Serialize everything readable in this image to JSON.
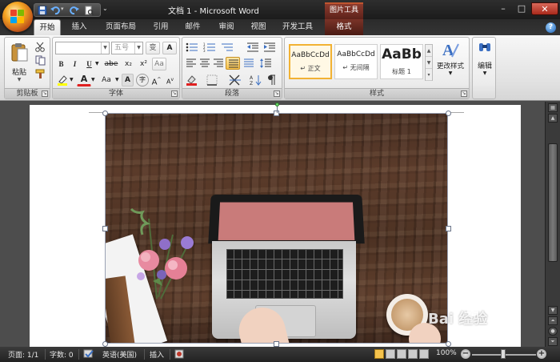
{
  "window": {
    "title": "文档 1 - Microsoft Word",
    "context_group": "图片工具",
    "min_label": "–",
    "max_label": "□",
    "close_label": "✕"
  },
  "quick_access": {
    "icons": [
      "save-icon",
      "undo-icon",
      "redo-icon",
      "print-preview-icon"
    ],
    "more": "⌄"
  },
  "tabs": [
    {
      "label": "开始",
      "active": true
    },
    {
      "label": "插入"
    },
    {
      "label": "页面布局"
    },
    {
      "label": "引用"
    },
    {
      "label": "邮件"
    },
    {
      "label": "审阅"
    },
    {
      "label": "视图"
    },
    {
      "label": "开发工具"
    },
    {
      "label": "格式",
      "contextual": true
    }
  ],
  "help": "?",
  "ribbon": {
    "clipboard": {
      "label": "剪贴板",
      "paste": "粘贴"
    },
    "font": {
      "label": "字体",
      "font_name": "",
      "font_size": "五号",
      "bold": "B",
      "italic": "I",
      "underline": "U",
      "strike": "abe",
      "subscript": "x₂",
      "superscript": "x²",
      "change_case": "Aa",
      "font_color": "A",
      "grow": "A",
      "shrink": "A",
      "char_border": "A",
      "phonetic": "变",
      "enclose": "字"
    },
    "paragraph": {
      "label": "段落"
    },
    "styles": {
      "label": "样式",
      "items": [
        {
          "sample": "AaBbCcDd",
          "name": "↵ 正文",
          "selected": true
        },
        {
          "sample": "AaBbCcDd",
          "name": "↵ 无间隔"
        },
        {
          "sample": "AaBb",
          "name": "标题 1"
        }
      ],
      "change_styles": "更改样式"
    },
    "editing": {
      "label": "编辑"
    }
  },
  "status": {
    "page": "页面: 1/1",
    "words": "字数: 0",
    "language": "英语(美国)",
    "mode": "插入",
    "zoom": "100%",
    "zoom_minus": "−",
    "zoom_plus": "+"
  },
  "colors": {
    "accent_context": "#8c3b2e",
    "highlight": "#ffff00",
    "font_red": "#e02020",
    "screen": "#c97b7a"
  },
  "watermark": "Bai 经验"
}
